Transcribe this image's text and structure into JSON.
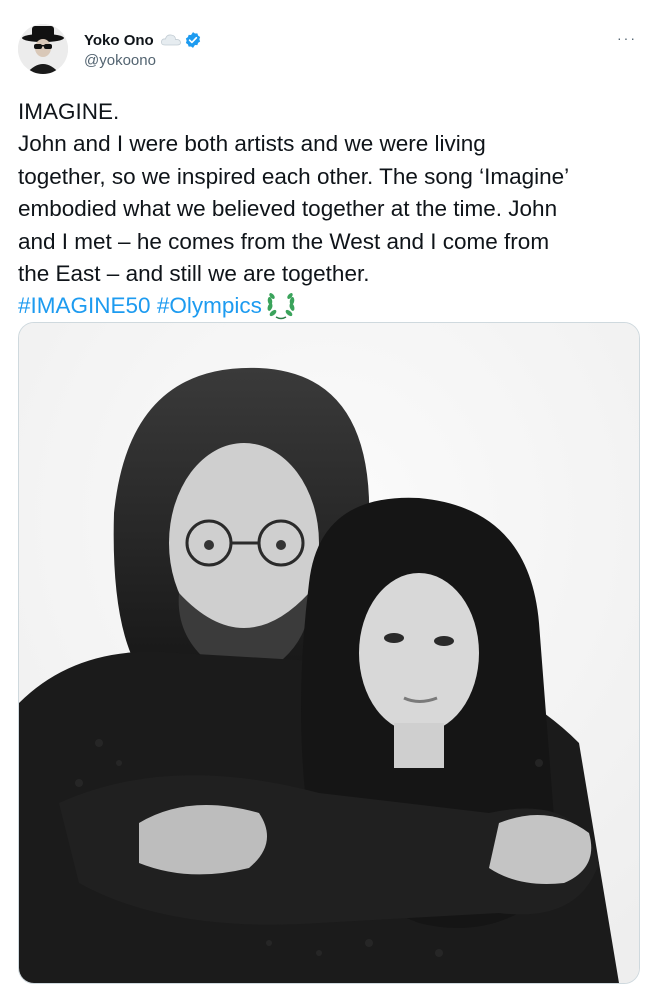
{
  "author": {
    "display_name": "Yoko Ono",
    "handle": "@yokoono",
    "avatar_icon": "profile-photo-avatar",
    "badge_icon": "cloud-icon",
    "verified_icon": "verified-badge-icon"
  },
  "more_icon": "more-options-icon",
  "more_label": "···",
  "tweet": {
    "heading": "IMAGINE.",
    "body_lines": [
      "John and I were both artists and we were living",
      "together, so we inspired each other. The song ‘Imagine’",
      "embodied what we believed together at the time. John",
      "and I met – he comes from the West and I come from",
      "the East – and still we are together."
    ],
    "hashtags": [
      "#IMAGINE50",
      "#Olympics"
    ],
    "emoji_icon": "olympic-laurel-icon"
  },
  "media": {
    "type": "black-and-white photo",
    "icon": "photo-image"
  },
  "colors": {
    "link": "#1d9bf0",
    "secondary_text": "#536471",
    "verified": "#1d9bf0",
    "border": "#cfd9de"
  }
}
